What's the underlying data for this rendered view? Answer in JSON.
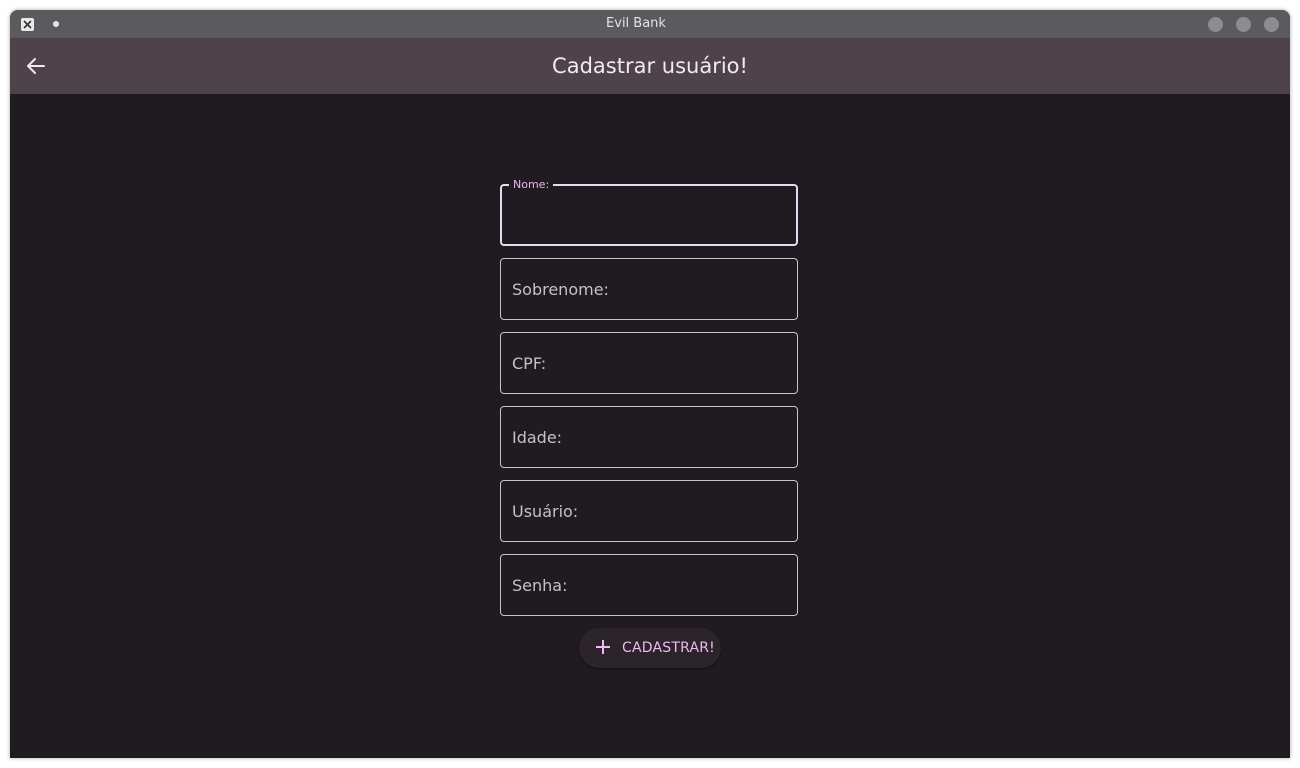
{
  "window": {
    "title": "Evil Bank",
    "app_icon": "x-app-icon",
    "pin_icon": "dot-icon",
    "controls": [
      "minimize-button",
      "maximize-button",
      "close-button"
    ]
  },
  "appbar": {
    "back_icon": "arrow-left-icon",
    "title": "Cadastrar usuário!"
  },
  "form": {
    "fields": [
      {
        "label": "Nome:",
        "value": "",
        "focused": true
      },
      {
        "label": "Sobrenome:",
        "value": "",
        "focused": false
      },
      {
        "label": "CPF:",
        "value": "",
        "focused": false
      },
      {
        "label": "Idade:",
        "value": "",
        "focused": false
      },
      {
        "label": "Usuário:",
        "value": "",
        "focused": false
      },
      {
        "label": "Senha:",
        "value": "",
        "focused": false
      }
    ],
    "submit": {
      "icon": "plus-icon",
      "label": "CADASTRAR!"
    }
  },
  "colors": {
    "background": "#201b20",
    "titlebar": "#5b5b5f",
    "appbar": "#4e434b",
    "accent": "#efb9f5",
    "field_border": "#c9c2c7"
  }
}
